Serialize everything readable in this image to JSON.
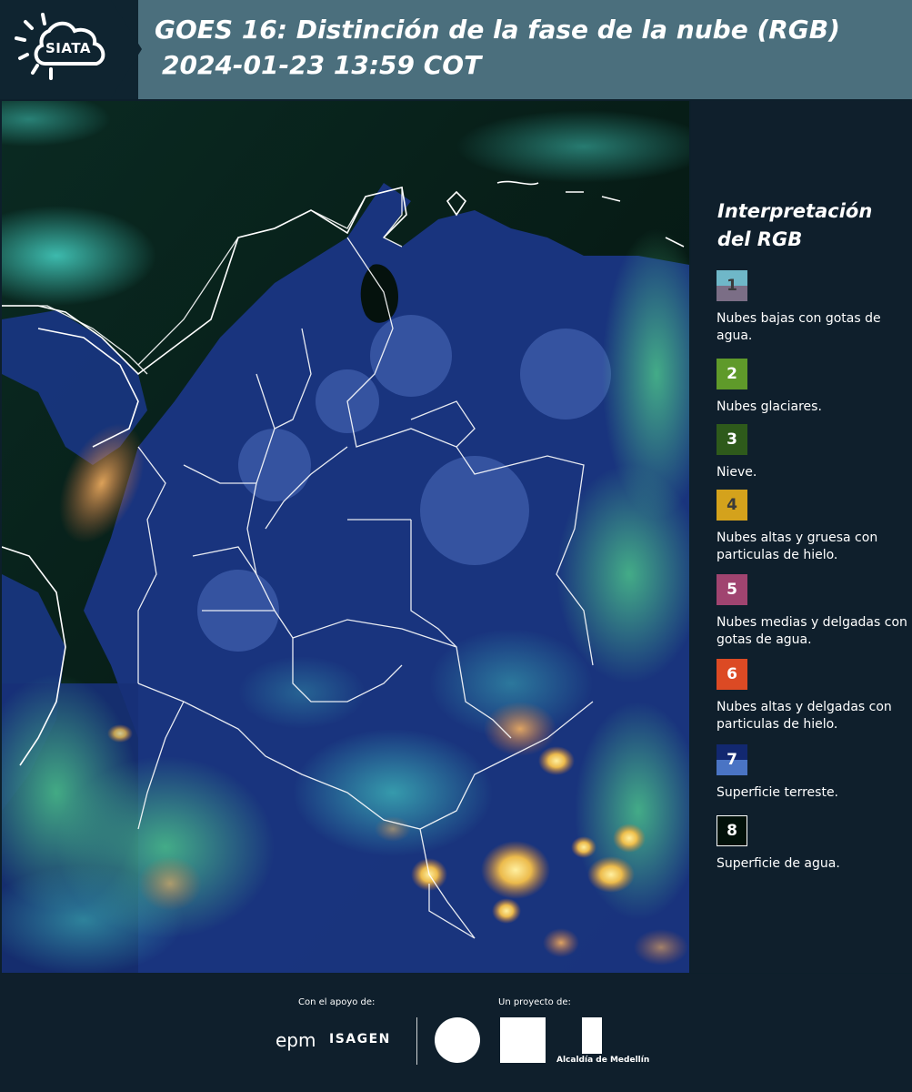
{
  "header": {
    "logo_text": "SIATA",
    "title": "GOES 16: Distinción de la fase de la nube (RGB)",
    "subtitle": "2024-01-23 13:59 COT"
  },
  "map": {
    "icon": "satellite-rgb-composite-map"
  },
  "legend": {
    "title_line1": "Interpretación",
    "title_line2": "del RGB",
    "items": [
      {
        "num": "1",
        "label": "Nubes bajas con gotas de agua.",
        "color_top": "#6fb7c8",
        "color_bottom": "#7b6e86",
        "num_color": "#3a3a3a"
      },
      {
        "num": "2",
        "label": "Nubes glaciares.",
        "color_top": "#5f9a2a",
        "num_color": "#ffffff"
      },
      {
        "num": "3",
        "label": "Nieve.",
        "color_top": "#2e5a1b",
        "num_color": "#ffffff"
      },
      {
        "num": "4",
        "label": "Nubes altas y gruesa con particulas de hielo.",
        "color_top": "#d4a21c",
        "num_color": "#3a3a3a"
      },
      {
        "num": "5",
        "label": "Nubes medias y delgadas con gotas de agua.",
        "color_top": "#a04470",
        "num_color": "#ffffff"
      },
      {
        "num": "6",
        "label": "Nubes altas y delgadas con particulas de hielo.",
        "color_top": "#dc4a24",
        "num_color": "#ffffff"
      },
      {
        "num": "7",
        "label": "Superficie terreste.",
        "color_top": "#122870",
        "color_bottom": "#4a74c4",
        "num_color": "#ffffff"
      },
      {
        "num": "8",
        "label": "Superficie de agua.",
        "color_top": "#02110a",
        "num_color": "#ffffff",
        "border": "#ffffff"
      }
    ]
  },
  "footer": {
    "support_label": "Con el apoyo de:",
    "project_label": "Un proyecto de:",
    "epm": "epm",
    "isagen": "ISAGEN",
    "alcaldia": "Alcaldía de Medellín"
  }
}
